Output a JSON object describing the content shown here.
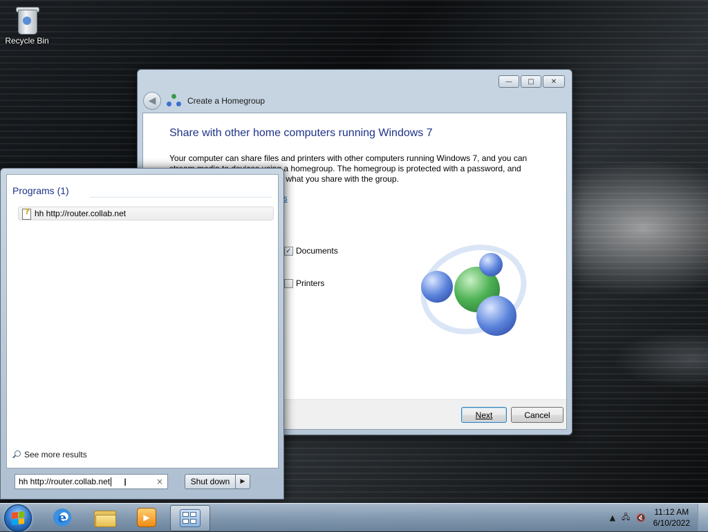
{
  "desktop": {
    "recycle_bin_label": "Recycle Bin"
  },
  "wizard": {
    "title": "Create a Homegroup",
    "heading": "Share with other home computers running Windows 7",
    "description": "Your computer can share files and printers with other computers running Windows 7, and you can stream media to devices using a homegroup. The homegroup is protected with a password, and you'll always be able to choose what you share with the group.",
    "link_fragment": "ps",
    "checkboxes": [
      {
        "label": "Documents",
        "checked": true
      },
      {
        "label": "Printers",
        "checked": false
      }
    ],
    "next_label": "Next",
    "cancel_label": "Cancel",
    "window_controls": {
      "minimize": "—",
      "maximize": "□",
      "close": "✕"
    }
  },
  "start_menu": {
    "group_header": "Programs (1)",
    "result_item": "hh http://router.collab.net",
    "see_more": "See more results",
    "search_value": "hh http://router.collab.net",
    "clear_symbol": "×",
    "shutdown_label": "Shut down",
    "shutdown_arrow": "▶"
  },
  "taskbar": {
    "time": "11:12 AM",
    "date": "6/10/2022",
    "tray_chevron": "▲"
  }
}
